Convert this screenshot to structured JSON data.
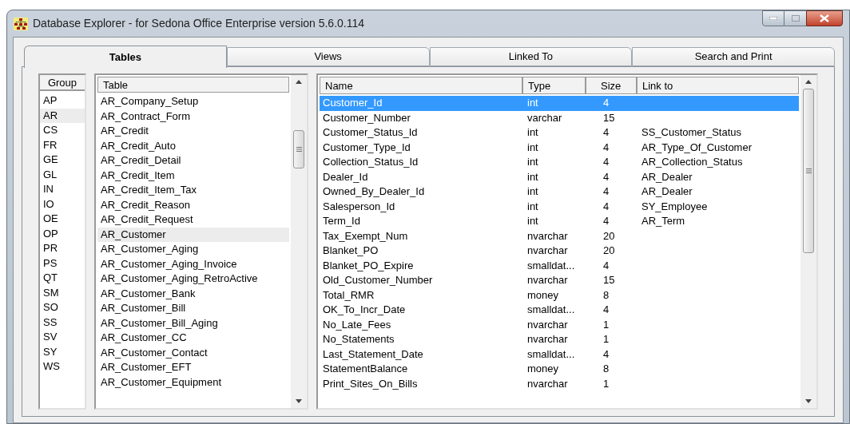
{
  "window": {
    "title": "Database Explorer - for Sedona Office Enterprise version 5.6.0.114"
  },
  "tabs": [
    {
      "label": "Tables",
      "selected": true
    },
    {
      "label": "Views",
      "selected": false
    },
    {
      "label": "Linked To",
      "selected": false
    },
    {
      "label": "Search and Print",
      "selected": false
    }
  ],
  "groups": {
    "header": "Group",
    "items": [
      {
        "label": "AP",
        "selected": false
      },
      {
        "label": "AR",
        "selected": true
      },
      {
        "label": "CS",
        "selected": false
      },
      {
        "label": "FR",
        "selected": false
      },
      {
        "label": "GE",
        "selected": false
      },
      {
        "label": "GL",
        "selected": false
      },
      {
        "label": "IN",
        "selected": false
      },
      {
        "label": "IO",
        "selected": false
      },
      {
        "label": "OE",
        "selected": false
      },
      {
        "label": "OP",
        "selected": false
      },
      {
        "label": "PR",
        "selected": false
      },
      {
        "label": "PS",
        "selected": false
      },
      {
        "label": "QT",
        "selected": false
      },
      {
        "label": "SM",
        "selected": false
      },
      {
        "label": "SO",
        "selected": false
      },
      {
        "label": "SS",
        "selected": false
      },
      {
        "label": "SV",
        "selected": false
      },
      {
        "label": "SY",
        "selected": false
      },
      {
        "label": "WS",
        "selected": false
      }
    ]
  },
  "tables": {
    "header": "Table",
    "items": [
      {
        "label": "AR_Company_Setup",
        "selected": false
      },
      {
        "label": "AR_Contract_Form",
        "selected": false
      },
      {
        "label": "AR_Credit",
        "selected": false
      },
      {
        "label": "AR_Credit_Auto",
        "selected": false
      },
      {
        "label": "AR_Credit_Detail",
        "selected": false
      },
      {
        "label": "AR_Credit_Item",
        "selected": false
      },
      {
        "label": "AR_Credit_Item_Tax",
        "selected": false
      },
      {
        "label": "AR_Credit_Reason",
        "selected": false
      },
      {
        "label": "AR_Credit_Request",
        "selected": false
      },
      {
        "label": "AR_Customer",
        "selected": true
      },
      {
        "label": "AR_Customer_Aging",
        "selected": false
      },
      {
        "label": "AR_Customer_Aging_Invoice",
        "selected": false
      },
      {
        "label": "AR_Customer_Aging_RetroActive",
        "selected": false
      },
      {
        "label": "AR_Customer_Bank",
        "selected": false
      },
      {
        "label": "AR_Customer_Bill",
        "selected": false
      },
      {
        "label": "AR_Customer_Bill_Aging",
        "selected": false
      },
      {
        "label": "AR_Customer_CC",
        "selected": false
      },
      {
        "label": "AR_Customer_Contact",
        "selected": false
      },
      {
        "label": "AR_Customer_EFT",
        "selected": false
      },
      {
        "label": "AR_Customer_Equipment",
        "selected": false
      }
    ]
  },
  "fields": {
    "columns": [
      "Name",
      "Type",
      "Size",
      "Link to"
    ],
    "rows": [
      {
        "name": "Customer_Id",
        "type": "int",
        "size": "4",
        "selected": true
      },
      {
        "name": "Customer_Number",
        "type": "varchar",
        "size": "15",
        "selected": false
      },
      {
        "name": "Customer_Status_Id",
        "type": "int",
        "size": "4",
        "link_to": "SS_Customer_Status",
        "selected": false
      },
      {
        "name": "Customer_Type_Id",
        "type": "int",
        "size": "4",
        "link_to": "AR_Type_Of_Customer",
        "selected": false
      },
      {
        "name": "Collection_Status_Id",
        "type": "int",
        "size": "4",
        "link_to": "AR_Collection_Status",
        "selected": false
      },
      {
        "name": "Dealer_Id",
        "type": "int",
        "size": "4",
        "link_to": "AR_Dealer",
        "selected": false
      },
      {
        "name": "Owned_By_Dealer_Id",
        "type": "int",
        "size": "4",
        "link_to": "AR_Dealer",
        "selected": false
      },
      {
        "name": "Salesperson_Id",
        "type": "int",
        "size": "4",
        "link_to": "SY_Employee",
        "selected": false
      },
      {
        "name": "Term_Id",
        "type": "int",
        "size": "4",
        "link_to": "AR_Term",
        "selected": false
      },
      {
        "name": "Tax_Exempt_Num",
        "type": "nvarchar",
        "size": "20",
        "selected": false
      },
      {
        "name": "Blanket_PO",
        "type": "nvarchar",
        "size": "20",
        "selected": false
      },
      {
        "name": "Blanket_PO_Expire",
        "type": "smalldat...",
        "size": "4",
        "selected": false
      },
      {
        "name": "Old_Customer_Number",
        "type": "nvarchar",
        "size": "15",
        "selected": false
      },
      {
        "name": "Total_RMR",
        "type": "money",
        "size": "8",
        "selected": false
      },
      {
        "name": "OK_To_Incr_Date",
        "type": "smalldat...",
        "size": "4",
        "selected": false
      },
      {
        "name": "No_Late_Fees",
        "type": "nvarchar",
        "size": "1",
        "selected": false
      },
      {
        "name": "No_Statements",
        "type": "nvarchar",
        "size": "1",
        "selected": false
      },
      {
        "name": "Last_Statement_Date",
        "type": "smalldat...",
        "size": "4",
        "selected": false
      },
      {
        "name": "StatementBalance",
        "type": "money",
        "size": "8",
        "selected": false
      },
      {
        "name": "Print_Sites_On_Bills",
        "type": "nvarchar",
        "size": "1",
        "selected": false
      }
    ]
  }
}
